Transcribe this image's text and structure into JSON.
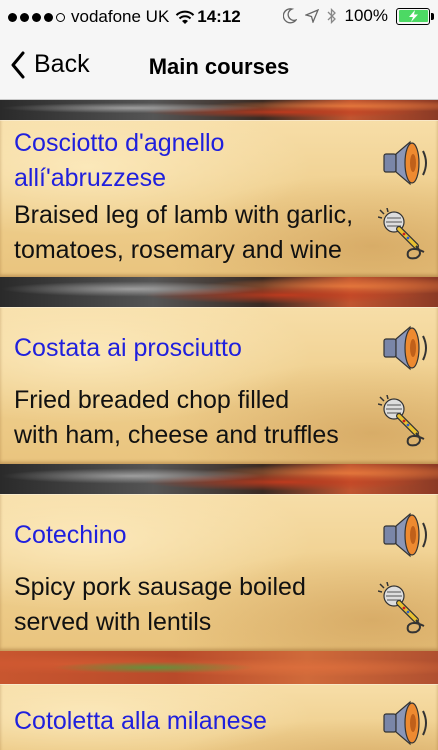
{
  "status": {
    "carrier": "vodafone UK",
    "time": "14:12",
    "battery": "100%",
    "signal_bars_filled": 4,
    "signal_bars_total": 5
  },
  "nav": {
    "back_label": "Back",
    "title": "Main courses"
  },
  "dishes": [
    {
      "name_line1": "Cosciotto d'agnello",
      "name_line2": "allí'abruzzese",
      "desc_line1": "Braised leg of lamb with garlic,",
      "desc_line2": "tomatoes, rosemary and wine"
    },
    {
      "name_line1": "Costata ai prosciutto",
      "desc_line1": "Fried breaded chop filled",
      "desc_line2": "with ham, cheese and truffles"
    },
    {
      "name_line1": "Cotechino",
      "desc_line1": "Spicy pork sausage boiled",
      "desc_line2": "served with lentils"
    },
    {
      "name_line1": "Cotoletta alla milanese"
    }
  ],
  "colors": {
    "dish_name": "#2020dd",
    "dish_desc": "#111111",
    "battery_fill": "#4cd964"
  },
  "icons": {
    "play": "speaker-icon",
    "record": "microphone-icon"
  }
}
